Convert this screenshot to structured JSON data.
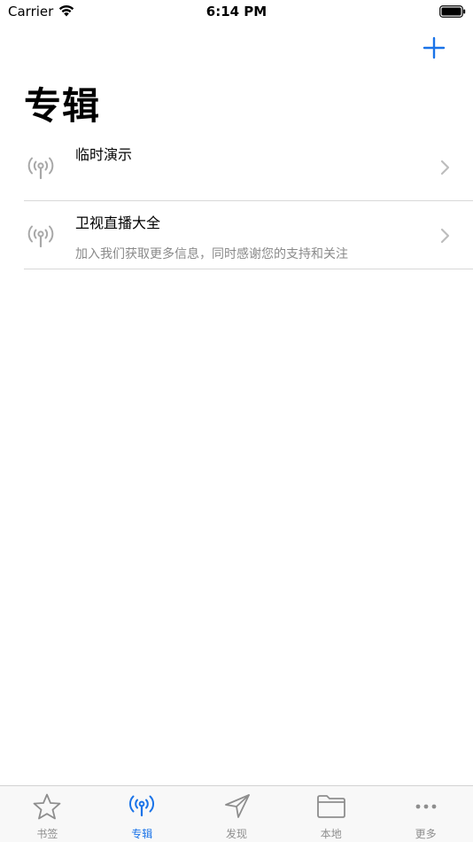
{
  "status_bar": {
    "carrier": "Carrier",
    "time": "6:14 PM"
  },
  "header": {
    "title": "专辑"
  },
  "list": {
    "items": [
      {
        "title": "临时演示",
        "subtitle": ""
      },
      {
        "title": "卫视直播大全",
        "subtitle": "加入我们获取更多信息，同时感谢您的支持和关注"
      }
    ]
  },
  "tabs": [
    {
      "label": "书签",
      "icon": "star-icon",
      "active": false
    },
    {
      "label": "专辑",
      "icon": "antenna-icon",
      "active": true
    },
    {
      "label": "发现",
      "icon": "paper-plane-icon",
      "active": false
    },
    {
      "label": "本地",
      "icon": "folder-icon",
      "active": false
    },
    {
      "label": "更多",
      "icon": "ellipsis-icon",
      "active": false
    }
  ],
  "colors": {
    "accent": "#1a73e8",
    "inactive": "#8e8e8e",
    "divider": "#d8d8d8"
  }
}
